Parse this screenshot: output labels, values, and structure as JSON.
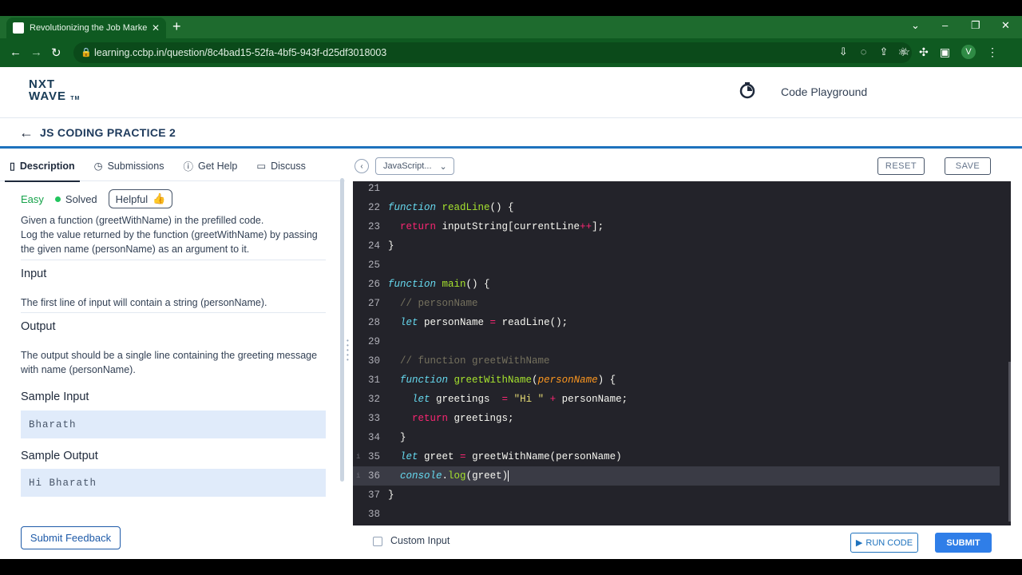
{
  "browser": {
    "tab_title": "Revolutionizing the Job Market |",
    "url": "learning.ccbp.in/question/8c4bad15-52fa-4bf5-943f-d25df3018003",
    "avatar_letter": "V"
  },
  "header": {
    "logo_line1": "NXT",
    "logo_line2": "WAVE",
    "logo_tm": "TM",
    "playground_label": "Code Playground"
  },
  "page": {
    "title": "JS CODING PRACTICE 2"
  },
  "left_tabs": [
    {
      "label": "Description"
    },
    {
      "label": "Submissions"
    },
    {
      "label": "Get Help"
    },
    {
      "label": "Discuss"
    }
  ],
  "problem": {
    "difficulty": "Easy",
    "status": "Solved",
    "helpful_label": "Helpful",
    "description_line1": "Given a function (greetWithName) in the prefilled code.",
    "description_line2": "Log the value returned by the function (greetWithName) by passing the given name (personName) as an argument to it.",
    "input_title": "Input",
    "input_text": "The first line of input will contain a string (personName).",
    "output_title": "Output",
    "output_text": "The output should be a single line containing the greeting message with name (personName).",
    "sample_input_title": "Sample Input",
    "sample_input": "Bharath",
    "sample_output_title": "Sample Output",
    "sample_output": "Hi Bharath",
    "feedback_label": "Submit Feedback"
  },
  "editor": {
    "language": "JavaScript...",
    "reset_label": "RESET",
    "save_label": "SAVE",
    "line_numbers": [
      "21",
      "22",
      "23",
      "24",
      "25",
      "26",
      "27",
      "28",
      "29",
      "30",
      "31",
      "32",
      "33",
      "34",
      "35",
      "36",
      "37",
      "38"
    ],
    "custom_input_label": "Custom Input",
    "run_label": "RUN CODE",
    "submit_label": "SUBMIT"
  },
  "colors": {
    "brand_blue": "#1e72bd",
    "editor_bg": "#23232a",
    "easy_green": "#16a34a",
    "submit_blue": "#2f7ee8"
  }
}
